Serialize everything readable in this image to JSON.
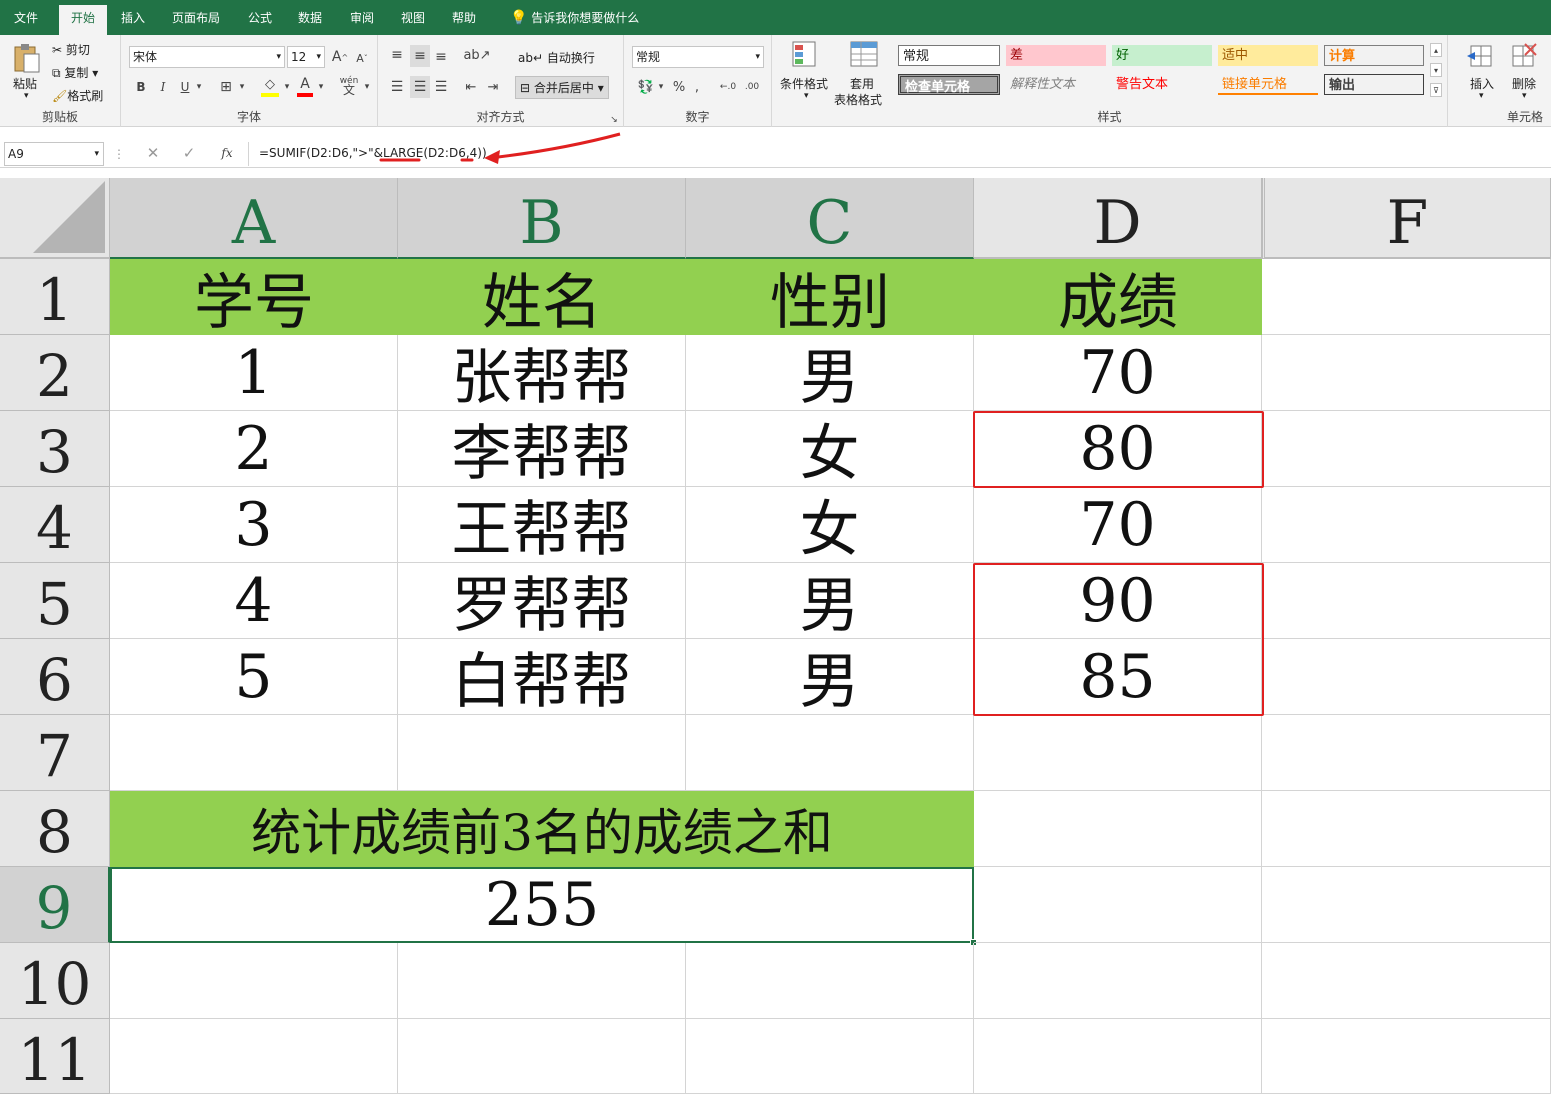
{
  "menu_tabs": [
    "文件",
    "开始",
    "插入",
    "页面布局",
    "公式",
    "数据",
    "审阅",
    "视图",
    "帮助"
  ],
  "tell_me": "告诉我你想要做什么",
  "ribbon": {
    "clipboard": {
      "paste": "粘贴",
      "cut": "剪切",
      "copy": "复制",
      "format_painter": "格式刷",
      "label": "剪贴板"
    },
    "font": {
      "name": "宋体",
      "size": "12",
      "label": "字体",
      "phonetic": "wén"
    },
    "align": {
      "wrap": "自动换行",
      "merge": "合并后居中",
      "label": "对齐方式"
    },
    "number": {
      "format": "常规",
      "label": "数字"
    },
    "styles": {
      "conditional": "条件格式",
      "table_format_1": "套用",
      "table_format_2": "表格格式",
      "label": "样式",
      "cells": [
        {
          "text": "常规",
          "bg": "#ffffff",
          "color": "#000000"
        },
        {
          "text": "差",
          "bg": "#ffc7ce",
          "color": "#9c0006"
        },
        {
          "text": "好",
          "bg": "#c6efce",
          "color": "#006100"
        },
        {
          "text": "适中",
          "bg": "#ffeb9c",
          "color": "#9c5700"
        },
        {
          "text": "计算",
          "bg": "#f2f2f2",
          "color": "#fa7d00"
        },
        {
          "text": "检查单元格",
          "bg": "#a5a5a5",
          "color": "#ffffff"
        },
        {
          "text": "解释性文本",
          "bg": "#f3f3f3",
          "color": "#7f7f7f"
        },
        {
          "text": "警告文本",
          "bg": "#f3f3f3",
          "color": "#ff0000"
        },
        {
          "text": "链接单元格",
          "bg": "#f3f3f3",
          "color": "#fa7d00"
        },
        {
          "text": "输出",
          "bg": "#f2f2f2",
          "color": "#3f3f3f"
        }
      ]
    },
    "cells_group": {
      "insert": "插入",
      "delete": "删除",
      "label": "单元格"
    }
  },
  "formula_bar": {
    "name_box": "A9",
    "fx": "fx",
    "formula": "=SUMIF(D2:D6,\">\"&LARGE(D2:D6,4))"
  },
  "columns": [
    "A",
    "B",
    "C",
    "D",
    "F"
  ],
  "rows": [
    "1",
    "2",
    "3",
    "4",
    "5",
    "6",
    "7",
    "8",
    "9",
    "10",
    "11"
  ],
  "table": {
    "headers": [
      "学号",
      "姓名",
      "性别",
      "成绩"
    ],
    "data": [
      [
        "1",
        "张帮帮",
        "男",
        "70"
      ],
      [
        "2",
        "李帮帮",
        "女",
        "80"
      ],
      [
        "3",
        "王帮帮",
        "女",
        "70"
      ],
      [
        "4",
        "罗帮帮",
        "男",
        "90"
      ],
      [
        "5",
        "白帮帮",
        "男",
        "85"
      ]
    ],
    "summary_label": "统计成绩前3名的成绩之和",
    "result": "255"
  },
  "colors": {
    "excel_green": "#217346",
    "header_fill": "#92d050",
    "highlight": "#e02020"
  }
}
